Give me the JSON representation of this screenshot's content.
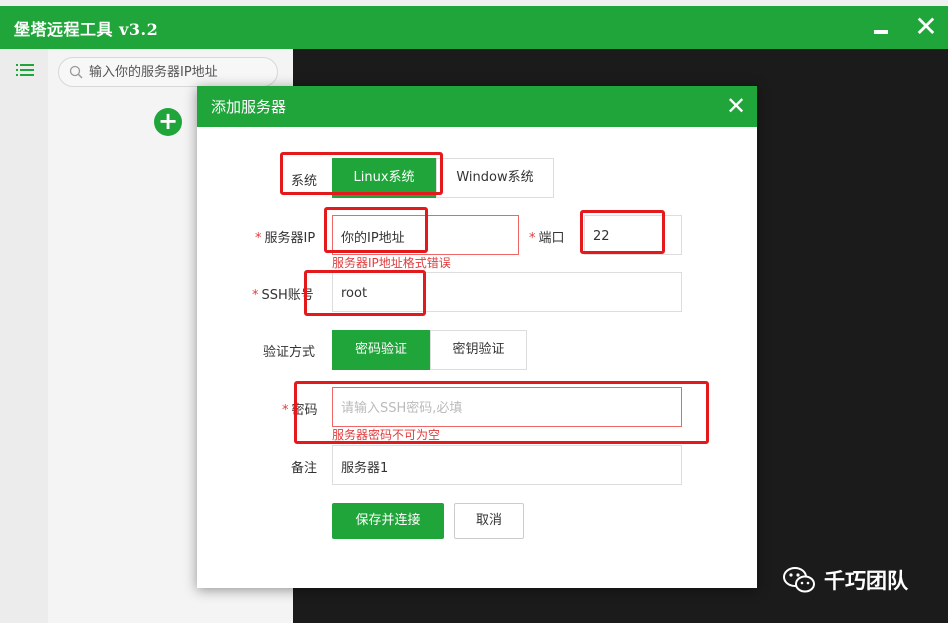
{
  "app": {
    "title": "堡塔远程工具  v3.2",
    "minimize_icon": "minimize-icon",
    "close_icon": "close-icon"
  },
  "sidebar": {
    "menu_icon": "list-icon",
    "search_placeholder": "输入你的服务器IP地址",
    "add_icon": "plus-circle-icon"
  },
  "dialog": {
    "title": "添加服务器",
    "close_icon": "close-icon",
    "system": {
      "label": "系统",
      "options": [
        "Linux系统",
        "Window系统"
      ],
      "selected": "Linux系统"
    },
    "server_ip": {
      "required_mark": "*",
      "label": "服务器IP",
      "value": "你的IP地址",
      "error": "服务器IP地址格式错误"
    },
    "port": {
      "required_mark": "*",
      "label": "端口",
      "value": "22"
    },
    "ssh_account": {
      "required_mark": "*",
      "label": "SSH账号",
      "value": "root"
    },
    "auth": {
      "label": "验证方式",
      "options": [
        "密码验证",
        "密钥验证"
      ],
      "selected": "密码验证"
    },
    "password": {
      "required_mark": "*",
      "label": "密码",
      "placeholder": "请输入SSH密码,必填",
      "error": "服务器密码不可为空"
    },
    "note": {
      "label": "备注",
      "value": "服务器1"
    },
    "save_button": "保存并连接",
    "cancel_button": "取消"
  },
  "watermark": {
    "icon": "wechat-icon",
    "text": "千巧团队"
  },
  "colors": {
    "brand_green": "#20a53a",
    "error_red": "#e03c3c",
    "annotation_red": "#e3191c",
    "background_dark": "#1b1b1b"
  }
}
